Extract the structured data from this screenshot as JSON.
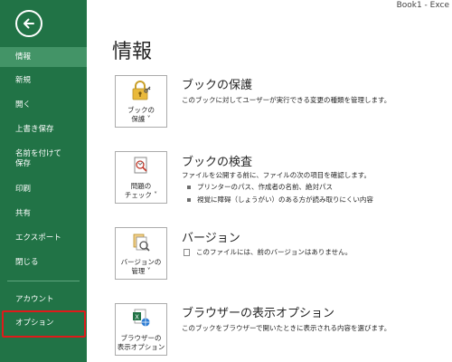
{
  "window": {
    "title": "Book1 - Exce"
  },
  "sidebar": {
    "items": [
      {
        "label": "情報"
      },
      {
        "label": "新規"
      },
      {
        "label": "開く"
      },
      {
        "label": "上書き保存"
      },
      {
        "label": "名前を付けて",
        "label2": "保存"
      },
      {
        "label": "印刷"
      },
      {
        "label": "共有"
      },
      {
        "label": "エクスポート"
      },
      {
        "label": "閉じる"
      },
      {
        "label": "アカウント"
      },
      {
        "label": "オプション"
      }
    ],
    "active_item": "情報",
    "accent_color": "#217346",
    "highlight_color": "#e01a1a"
  },
  "main": {
    "title": "情報",
    "sections": [
      {
        "tile_line1": "ブックの",
        "tile_line2": "保護 ˅",
        "title": "ブックの保護",
        "desc": "このブックに対してユーザーが実行できる変更の種類を管理します。",
        "icon": "lock-key-icon"
      },
      {
        "tile_line1": "問題の",
        "tile_line2": "チェック ˅",
        "title": "ブックの検査",
        "desc": "ファイルを公開する前に、ファイルの次の項目を確認します。",
        "bullets": [
          "プリンターのパス、作成者の名前、絶対パス",
          "視覚に障碍（しょうがい）のある方が読み取りにくい内容"
        ],
        "icon": "inspect-document-icon"
      },
      {
        "tile_line1": "バージョンの",
        "tile_line2": "管理 ˅",
        "title": "バージョン",
        "desc": "このファイルには、前のバージョンはありません。",
        "icon": "versions-icon"
      },
      {
        "tile_line1": "ブラウザーの",
        "tile_line2": "表示オプション",
        "title": "ブラウザーの表示オプション",
        "desc": "このブックをブラウザーで開いたときに表示される内容を選びます。",
        "icon": "browser-view-options-icon"
      }
    ]
  }
}
